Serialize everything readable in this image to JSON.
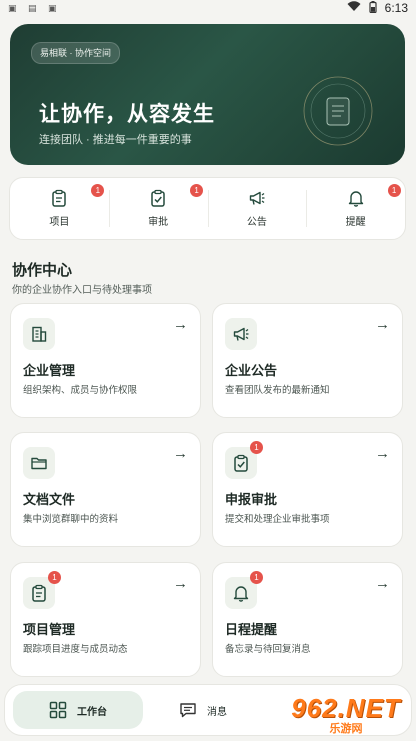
{
  "status_bar": {
    "left_icons": [
      "app-icon-1",
      "image-icon",
      "app-icon-2"
    ],
    "time": "6:13"
  },
  "banner": {
    "pill": "易相联 · 协作空间",
    "title": "让协作，从容发生",
    "subtitle": "连接团队 · 推进每一件重要的事"
  },
  "quick": [
    {
      "label": "项目",
      "icon": "clipboard-icon",
      "badge": "1"
    },
    {
      "label": "审批",
      "icon": "check-clipboard-icon",
      "badge": "1"
    },
    {
      "label": "公告",
      "icon": "megaphone-icon",
      "badge": ""
    },
    {
      "label": "提醒",
      "icon": "bell-icon",
      "badge": "1"
    }
  ],
  "section": {
    "title": "协作中心",
    "subtitle": "你的企业协作入口与待处理事项"
  },
  "cards": [
    {
      "title": "企业管理",
      "desc": "组织架构、成员与协作权限",
      "icon": "building-icon",
      "badge": ""
    },
    {
      "title": "企业公告",
      "desc": "查看团队发布的最新通知",
      "icon": "megaphone-icon",
      "badge": ""
    },
    {
      "title": "文档文件",
      "desc": "集中浏览群聊中的资料",
      "icon": "folder-icon",
      "badge": ""
    },
    {
      "title": "申报审批",
      "desc": "提交和处理企业审批事项",
      "icon": "check-clipboard-icon",
      "badge": "1"
    },
    {
      "title": "项目管理",
      "desc": "跟踪项目进度与成员动态",
      "icon": "clipboard-icon",
      "badge": "1"
    },
    {
      "title": "日程提醒",
      "desc": "备忘录与待回复消息",
      "icon": "bell-icon",
      "badge": "1"
    }
  ],
  "card_arrow": "→",
  "nav": [
    {
      "label": "工作台",
      "icon": "grid-icon"
    },
    {
      "label": "消息",
      "icon": "chat-icon"
    }
  ],
  "watermark": {
    "big": "962.NET",
    "small": "乐游网"
  },
  "colors": {
    "accent": "#244a3c",
    "badge": "#e5534b",
    "background": "#f4f4f1",
    "watermark": "#ff7a1a"
  }
}
